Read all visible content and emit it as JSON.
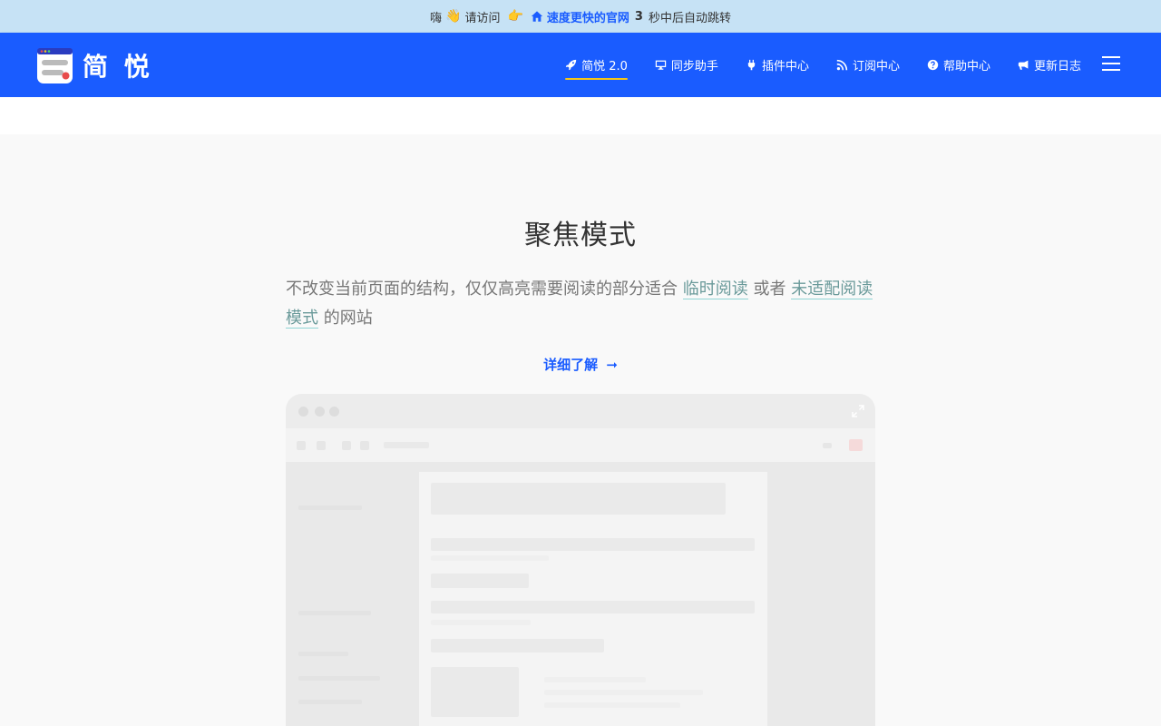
{
  "notice": {
    "prefix": "嗨",
    "wave_emoji": "👋",
    "visit": "请访问",
    "point_emoji": "👉",
    "link": "速度更快的官网",
    "count": "3",
    "suffix": "秒中后自动跳转"
  },
  "header": {
    "logo_text": "简 悦",
    "nav": [
      {
        "label": "简悦 2.0",
        "icon": "rocket-icon"
      },
      {
        "label": "同步助手",
        "icon": "desktop-icon"
      },
      {
        "label": "插件中心",
        "icon": "plug-icon"
      },
      {
        "label": "订阅中心",
        "icon": "rss-icon"
      },
      {
        "label": "帮助中心",
        "icon": "question-circle-icon"
      },
      {
        "label": "更新日志",
        "icon": "bullhorn-icon"
      }
    ],
    "menu_icon": "hamburger-icon"
  },
  "section": {
    "title": "聚焦模式",
    "desc_part1": "不改变当前页面的结构，仅仅高亮需要阅读的部分适合",
    "desc_link1": "临时阅读",
    "desc_part2": "或者",
    "desc_link2a": "未适配阅读",
    "desc_link2b": "模式",
    "desc_part3": "的网站",
    "more_label": "详细了解",
    "more_arrow": "➞"
  },
  "colors": {
    "brand": "#1a5cff",
    "notice_bg": "#c6e2f5",
    "active_underline": "#f5c518",
    "highlight_underline": "#8fd4d4"
  }
}
